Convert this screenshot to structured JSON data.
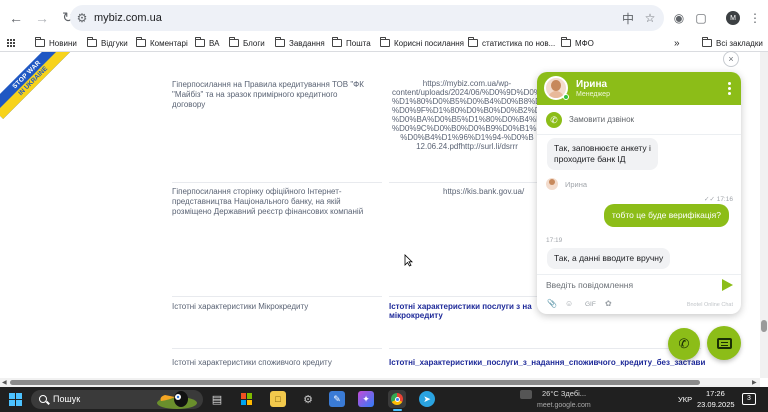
{
  "browser": {
    "url": "mybiz.com.ua",
    "icons": [
      "back-arrow-icon",
      "forward-arrow-icon",
      "reload-icon",
      "site-info-icon",
      "translate-icon",
      "star-icon",
      "camera-icon",
      "extensions-icon",
      "profile-icon",
      "menu-dots-icon"
    ],
    "profile_initial": "M"
  },
  "bookmarks": {
    "items": [
      "Новини",
      "Відгуки",
      "Коментарі",
      "ВА",
      "Блоги",
      "Завдання",
      "Пошта",
      "Корисні посилання",
      "статистика по нов...",
      "МФО"
    ],
    "more": "»",
    "all": "Всі закладки"
  },
  "page": {
    "ribbon_line1": "STOP WAR",
    "ribbon_line2": "IN UKRAINE",
    "rows": [
      {
        "left": "Гіперпосилання на Правила кредитування ТОВ \"ФК \"Майбіз\" та на зразок примірного кредитного договору",
        "right_lines": [
          "https://mybiz.com.ua/wp-",
          "content/uploads/2024/06/%D0%9D%D0%B",
          "%D1%80%D0%B5%D0%B4%D0%B8%D1%82%D",
          "%D0%9F%D1%80%D0%B0%D0%B2%D0%B8",
          "%D0%BA%D0%B5%D1%80%D0%B4%D0%B8",
          "%D0%9C%D0%B0%D0%B9%D0%B1%D1%",
          "%D0%B4%D1%96%D1%94-%D0%B",
          "12.06.24.pdfhttp://surl.li/dsrrr"
        ]
      },
      {
        "left": "Гіперпосилання сторінку офіційного Інтернет-представництва Національного банку, на якій розміщено Державний реєстр фінансових компаній",
        "right_lines": [
          "https://kis.bank.gov.ua/"
        ]
      },
      {
        "left": "Істотні характеристики Мікрокредиту",
        "right_lines": [
          "Істотні характеристики послуги з на",
          "мікрокредиту"
        ]
      },
      {
        "left": "Істотні характеристики споживчого кредиту",
        "right_lines": [
          "Істотні_характеристики_послуги_з_надання_споживчого_кредиту_без_застави"
        ]
      }
    ]
  },
  "chat": {
    "agent_name": "Ирина",
    "agent_role": "Менеджер",
    "call_label": "Замовити дзвінок",
    "messages": [
      {
        "from": "agent",
        "text_lines": [
          "Так, заповнюєте анкету і",
          "проходите банк ІД"
        ]
      },
      {
        "from": "agent_label",
        "name": "Ирина"
      },
      {
        "from": "user",
        "time": "17:16",
        "text": "тобто це буде верифікація?"
      },
      {
        "from": "agent",
        "time": "17:19",
        "text_lines": [
          "Так, а данні вводите вручну"
        ]
      }
    ],
    "input_placeholder": "Введіть повідомлення",
    "tools": [
      "attach-icon",
      "emoji-icon",
      "GIF",
      "stickers-icon"
    ],
    "gif_label": "GIF",
    "powered": "Bnotel Online Chat",
    "close": "×"
  },
  "taskbar": {
    "search_label": "Пошук",
    "weather": "26°C  Здебі...",
    "meet": "meet.google.com",
    "lang": "УКР",
    "time": "17:26",
    "date": "23.09.2025",
    "notifications": "3"
  },
  "colors": {
    "accent_green": "#8cbd18",
    "link_blue": "#1e2a99",
    "taskbar": "#202020"
  }
}
